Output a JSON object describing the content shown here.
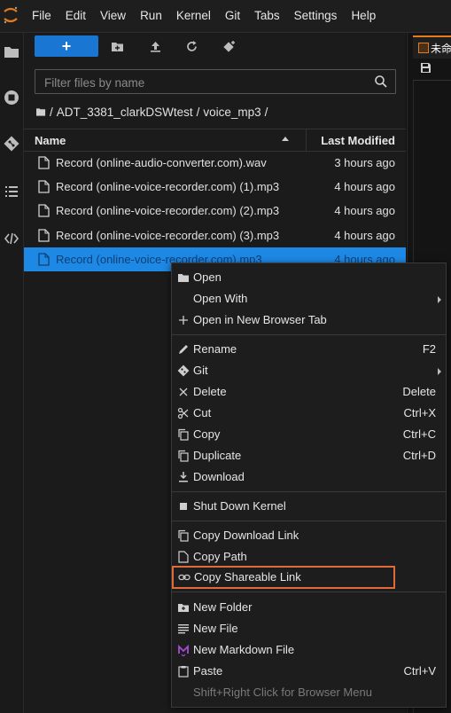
{
  "menubar": {
    "items": [
      "File",
      "Edit",
      "View",
      "Run",
      "Kernel",
      "Git",
      "Tabs",
      "Settings",
      "Help"
    ]
  },
  "activitybar": {
    "icons": [
      "folder-icon",
      "running-icon",
      "git-icon",
      "toc-icon",
      "extension-icon"
    ]
  },
  "filebrowser": {
    "new_label": "+",
    "filter_placeholder": "Filter files by name",
    "breadcrumb": [
      "ADT_3381_clarkDSWtest",
      "voice_mp3"
    ],
    "columns": {
      "name": "Name",
      "modified": "Last Modified"
    },
    "files": [
      {
        "name": "Record (online-audio-converter.com).wav",
        "modified": "3 hours ago",
        "selected": false
      },
      {
        "name": "Record (online-voice-recorder.com) (1).mp3",
        "modified": "4 hours ago",
        "selected": false
      },
      {
        "name": "Record (online-voice-recorder.com) (2).mp3",
        "modified": "4 hours ago",
        "selected": false
      },
      {
        "name": "Record (online-voice-recorder.com) (3).mp3",
        "modified": "4 hours ago",
        "selected": false
      },
      {
        "name": "Record (online-voice-recorder.com).mp3",
        "modified": "4 hours ago",
        "selected": true
      }
    ]
  },
  "editor": {
    "tab_title": "未命"
  },
  "context_menu": {
    "open": "Open",
    "open_with": "Open With",
    "open_new_tab": "Open in New Browser Tab",
    "rename": "Rename",
    "rename_sc": "F2",
    "git": "Git",
    "delete": "Delete",
    "delete_sc": "Delete",
    "cut": "Cut",
    "cut_sc": "Ctrl+X",
    "copy": "Copy",
    "copy_sc": "Ctrl+C",
    "duplicate": "Duplicate",
    "duplicate_sc": "Ctrl+D",
    "download": "Download",
    "shutdown_kernel": "Shut Down Kernel",
    "copy_download_link": "Copy Download Link",
    "copy_path": "Copy Path",
    "copy_shareable_link": "Copy Shareable Link",
    "new_folder": "New Folder",
    "new_file": "New File",
    "new_markdown": "New Markdown File",
    "paste": "Paste",
    "paste_sc": "Ctrl+V",
    "browser_menu_hint": "Shift+Right Click for Browser Menu"
  },
  "colors": {
    "accent": "#1976d2",
    "selection": "#1e88e5",
    "highlight_box": "#e06a3a",
    "jupyter_orange": "#e57c1c"
  }
}
